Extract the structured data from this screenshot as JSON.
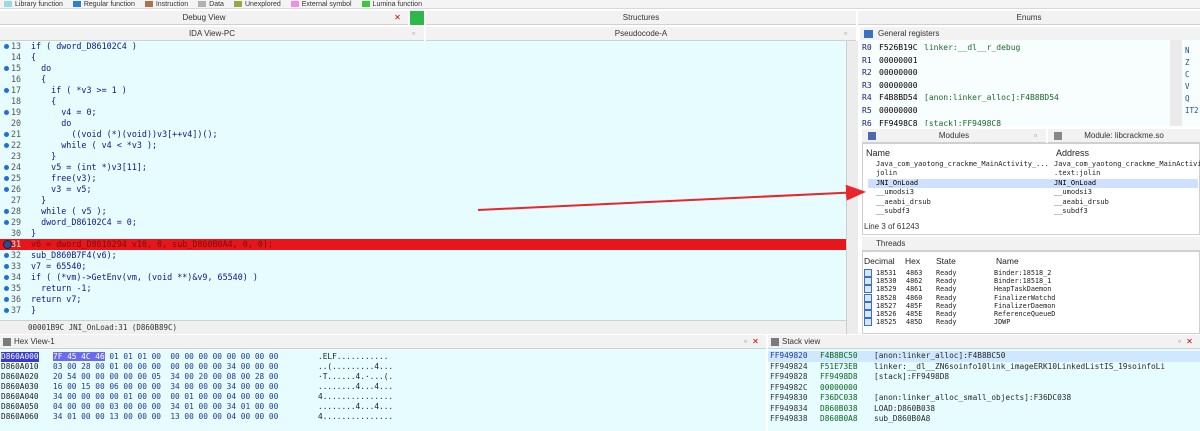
{
  "legend": [
    {
      "label": "Library function",
      "color": "#9dd8e8"
    },
    {
      "label": "Regular function",
      "color": "#2a7fd6"
    },
    {
      "label": "Instruction",
      "color": "#b07050"
    },
    {
      "label": "Data",
      "color": "#b0b0b0"
    },
    {
      "label": "Unexplored",
      "color": "#9aa64a"
    },
    {
      "label": "External symbol",
      "color": "#f08ee0"
    },
    {
      "label": "Lumina function",
      "color": "#3cc83c"
    }
  ],
  "titles": {
    "debug_view": "Debug View",
    "structures": "Structures",
    "enums": "Enums",
    "ida_view": "IDA View-PC",
    "pseudocode": "Pseudocode-A",
    "general_registers": "General registers",
    "modules": "Modules",
    "module_detail": "Module: libcrackme.so",
    "threads": "Threads",
    "hex_view": "Hex View-1",
    "stack_view": "Stack view"
  },
  "code_lines": [
    {
      "n": "13",
      "t": "if ( dword_D86102C4 )"
    },
    {
      "n": "14",
      "t": "{"
    },
    {
      "n": "15",
      "t": "  do"
    },
    {
      "n": "16",
      "t": "  {"
    },
    {
      "n": "17",
      "t": "    if ( *v3 >= 1 )"
    },
    {
      "n": "18",
      "t": "    {"
    },
    {
      "n": "19",
      "t": "      v4 = 0;"
    },
    {
      "n": "20",
      "t": "      do"
    },
    {
      "n": "21",
      "t": "        ((void (*)(void))v3[++v4])();"
    },
    {
      "n": "22",
      "t": "      while ( v4 < *v3 );"
    },
    {
      "n": "23",
      "t": "    }"
    },
    {
      "n": "24",
      "t": "    v5 = (int *)v3[11];"
    },
    {
      "n": "25",
      "t": "    free(v3);"
    },
    {
      "n": "26",
      "t": "    v3 = v5;"
    },
    {
      "n": "27",
      "t": "  }"
    },
    {
      "n": "28",
      "t": "  while ( v5 );"
    },
    {
      "n": "29",
      "t": "  dword_D86102C4 = 0;"
    },
    {
      "n": "30",
      "t": "}"
    },
    {
      "n": "31",
      "t": "v6 = dword_D8610294 v10, 0, sub_D860B0A4, 0, 0);"
    },
    {
      "n": "32",
      "t": "sub_D860B7F4(v6);"
    },
    {
      "n": "33",
      "t": "v7 = 65540;"
    },
    {
      "n": "34",
      "t": "if ( (*vm)->GetEnv(vm, (void **)&v9, 65540) )"
    },
    {
      "n": "35",
      "t": "  return -1;"
    },
    {
      "n": "36",
      "t": "return v7;"
    },
    {
      "n": "37",
      "t": "}"
    }
  ],
  "status_text": "00001B9C JNI_OnLoad:31 (D860B89C)",
  "registers": [
    {
      "name": "R0",
      "value": "F526B19C",
      "sym": "linker:__dl__r_debug"
    },
    {
      "name": "R1",
      "value": "00000001",
      "sym": ""
    },
    {
      "name": "R2",
      "value": "00000000",
      "sym": ""
    },
    {
      "name": "R3",
      "value": "00000000",
      "sym": ""
    },
    {
      "name": "R4",
      "value": "F4B8BD54",
      "sym": "[anon:linker_alloc]:F4B8BD54"
    },
    {
      "name": "R5",
      "value": "00000000",
      "sym": ""
    },
    {
      "name": "R6",
      "value": "FF9498C8",
      "sym": "[stack]:FF9498C8"
    }
  ],
  "flags": [
    "N",
    "Z",
    "C",
    "V",
    "Q",
    "IT2"
  ],
  "modules_header": {
    "name": "Name",
    "address": "Address"
  },
  "modules": [
    {
      "name": "Java_com_yaotong_crackme_MainActivity_...",
      "addr": "Java_com_yaotong_crackme_MainActivi"
    },
    {
      "name": "jolin",
      "addr": ".text:jolin"
    },
    {
      "name": "JNI_OnLoad",
      "addr": "JNI_OnLoad"
    },
    {
      "name": "__umodsi3",
      "addr": "__umodsi3"
    },
    {
      "name": "__aeabi_drsub",
      "addr": "__aeabi_drsub"
    },
    {
      "name": "__subdf3",
      "addr": "__subdf3"
    }
  ],
  "modules_status": "Line 3 of 61243",
  "threads_header": {
    "decimal": "Decimal",
    "hex": "Hex",
    "state": "State",
    "name": "Name"
  },
  "threads": [
    {
      "d": "18531",
      "h": "4863",
      "s": "Ready",
      "n": "Binder:18518_2"
    },
    {
      "d": "18530",
      "h": "4862",
      "s": "Ready",
      "n": "Binder:18518_1"
    },
    {
      "d": "18529",
      "h": "4861",
      "s": "Ready",
      "n": "HeapTaskDaemon"
    },
    {
      "d": "18528",
      "h": "4860",
      "s": "Ready",
      "n": "FinalizerWatchd"
    },
    {
      "d": "18527",
      "h": "485F",
      "s": "Ready",
      "n": "FinalizerDaemon"
    },
    {
      "d": "18526",
      "h": "485E",
      "s": "Ready",
      "n": "ReferenceQueueD"
    },
    {
      "d": "18525",
      "h": "485D",
      "s": "Ready",
      "n": "JDWP"
    }
  ],
  "hex_rows": [
    {
      "a": "D860A000",
      "sel": "7F 45 4C 46",
      "b": " 01 01 01 00  00 00 00 00 00 00 00 00",
      "s": ".ELF..........."
    },
    {
      "a": "D860A010",
      "sel": "",
      "b": "03 00 28 00 01 00 00 00  00 00 00 00 34 00 00 00",
      "s": "..(.........4..."
    },
    {
      "a": "D860A020",
      "sel": "",
      "b": "20 54 00 00 00 00 00 05  34 00 20 00 08 00 28 00",
      "s": "·T......4.·...(."
    },
    {
      "a": "D860A030",
      "sel": "",
      "b": "16 00 15 00 06 00 00 00  34 00 00 00 34 00 00 00",
      "s": "........4...4..."
    },
    {
      "a": "D860A040",
      "sel": "",
      "b": "34 00 00 00 00 01 00 00  00 01 00 00 04 00 00 00",
      "s": "4..............."
    },
    {
      "a": "D860A050",
      "sel": "",
      "b": "04 00 00 00 03 00 00 00  34 01 00 00 34 01 00 00",
      "s": "........4...4..."
    },
    {
      "a": "D860A060",
      "sel": "",
      "b": "34 01 00 00 13 00 00 00  13 00 00 00 04 00 00 00",
      "s": "4..............."
    }
  ],
  "stack_rows": [
    {
      "a": "FF949820",
      "v": "F4B8BC50",
      "c": "[anon:linker_alloc]:F4B8BC50"
    },
    {
      "a": "FF949824",
      "v": "F51E73EB",
      "c": "linker:__dl__ZN6soinfo10link_imageERK10LinkedListIS_19soinfoLi"
    },
    {
      "a": "FF949828",
      "v": "FF9498D8",
      "c": "[stack]:FF9498D8"
    },
    {
      "a": "FF94982C",
      "v": "00000000",
      "c": ""
    },
    {
      "a": "FF949830",
      "v": "F36DC038",
      "c": "[anon:linker_alloc_small_objects]:F36DC038"
    },
    {
      "a": "FF949834",
      "v": "D860B038",
      "c": "LOAD:D860B038"
    },
    {
      "a": "FF949838",
      "v": "D860B0A8",
      "c": "sub_D860B0A8"
    }
  ]
}
